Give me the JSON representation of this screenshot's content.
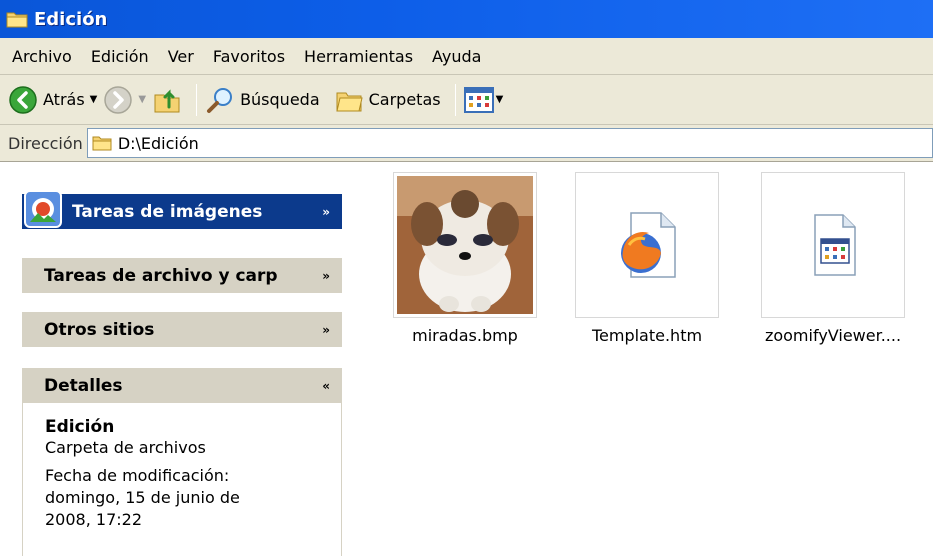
{
  "window": {
    "title": "Edición"
  },
  "menu": [
    "Archivo",
    "Edición",
    "Ver",
    "Favoritos",
    "Herramientas",
    "Ayuda"
  ],
  "toolbar": {
    "back_label": "Atrás",
    "search_label": "Búsqueda",
    "folders_label": "Carpetas"
  },
  "address": {
    "label": "Dirección",
    "value": "D:\\Edición"
  },
  "tasks": {
    "image_tasks": "Tareas de imágenes",
    "file_tasks": "Tareas de archivo y carp",
    "other_places": "Otros sitios",
    "details": "Detalles"
  },
  "details": {
    "name": "Edición",
    "type": "Carpeta de archivos",
    "modified_label": "Fecha de modificación:",
    "modified_line1": "domingo, 15 de junio de",
    "modified_line2": "2008, 17:22"
  },
  "files": [
    {
      "name": "miradas.bmp",
      "icon": "image-thumbnail"
    },
    {
      "name": "Template.htm",
      "icon": "firefox-html-icon"
    },
    {
      "name": "zoomifyViewer....",
      "icon": "executable-window-icon"
    }
  ],
  "colors": {
    "titlebar": "#0a56d8",
    "chrome": "#ece9d8",
    "taskpane_header_blue": "#0c3a8c",
    "taskpane_header_grey": "#d6d2c4"
  }
}
